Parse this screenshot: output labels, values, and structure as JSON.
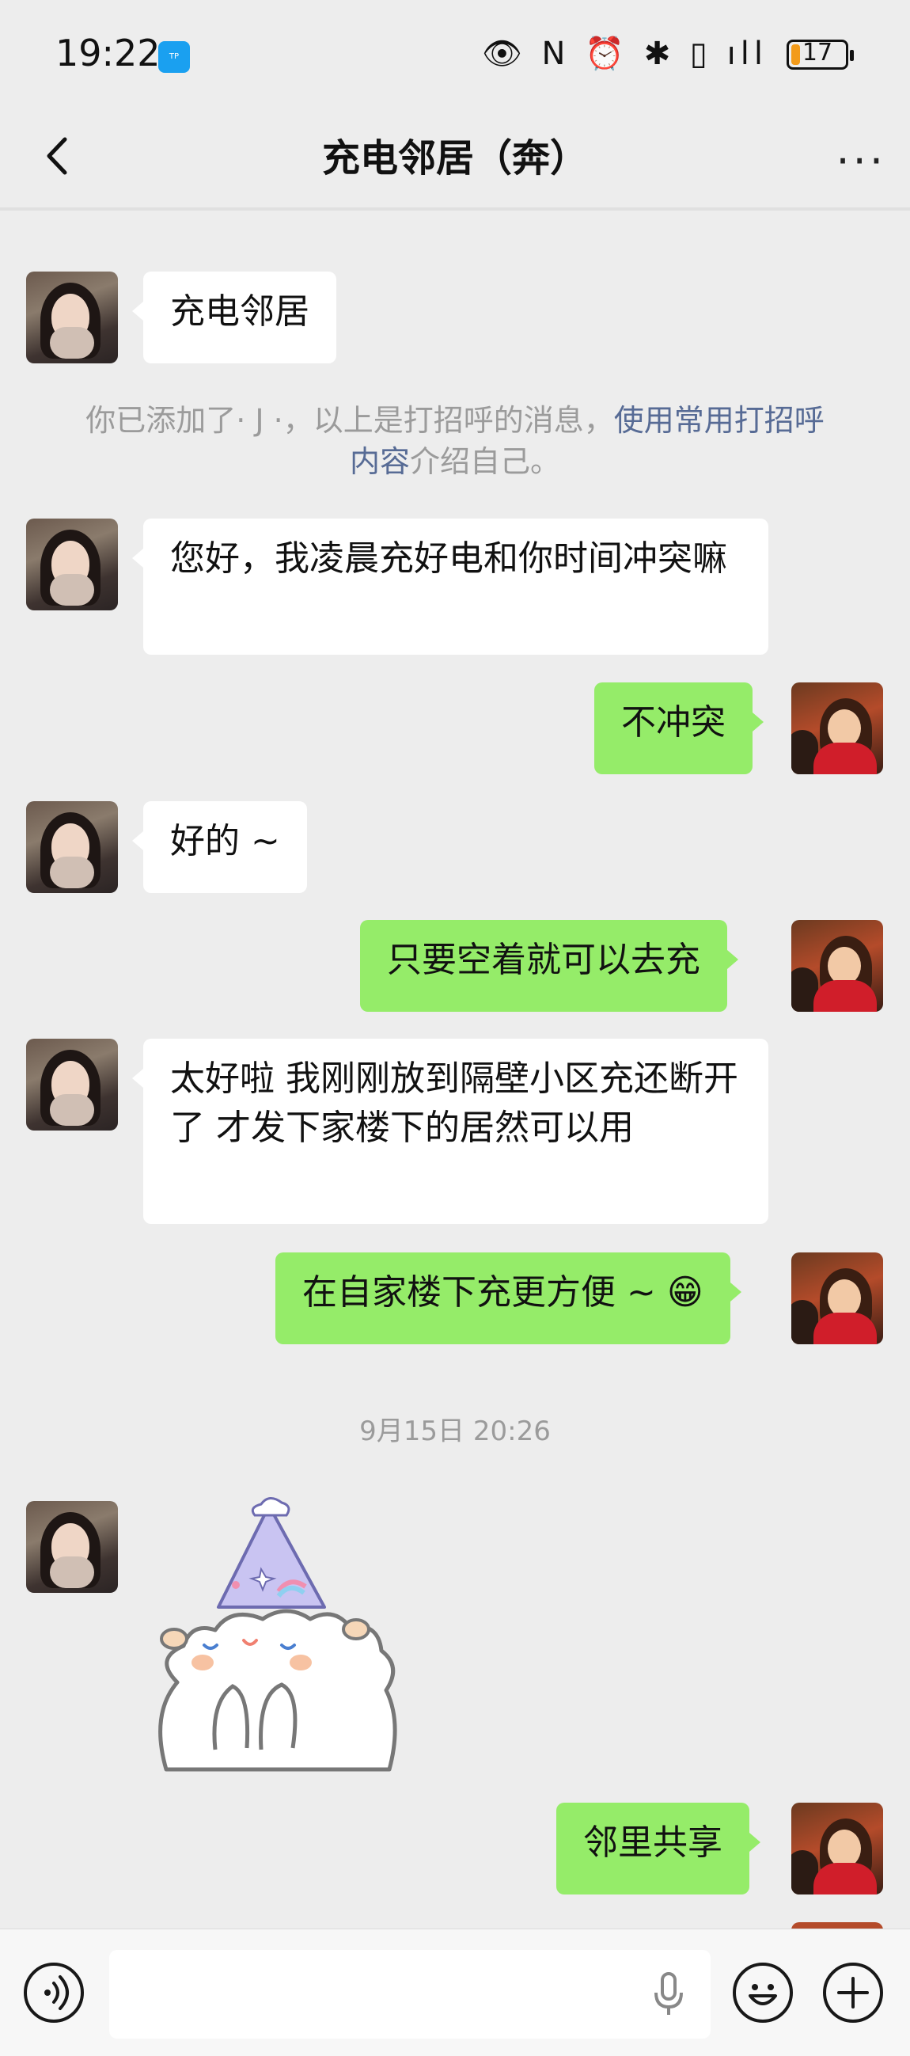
{
  "status_bar": {
    "time": "19:22",
    "app_icon": "tplink-app-icon",
    "system_icons": "👁 N ⏰ ✱ ▯ ıll",
    "battery_level": "17",
    "battery_fraction": 0.17
  },
  "header": {
    "title": "充电邻居（奔）",
    "more_icon": "more-dots-icon",
    "back_icon": "chevron-left-icon"
  },
  "messages": [
    {
      "side": "left",
      "text": "充电邻居"
    },
    {
      "side": "left",
      "text": "您好，我凌晨充好电和你时间冲突嘛"
    },
    {
      "side": "right",
      "text": "不冲突"
    },
    {
      "side": "left",
      "text": "好的 ~"
    },
    {
      "side": "right",
      "text": "只要空着就可以去充"
    },
    {
      "side": "left",
      "text": "太好啦 我刚刚放到隔壁小区充还断开了 才发下家楼下的居然可以用"
    },
    {
      "side": "right",
      "text": "在自家楼下充更方便 ~ 😁"
    },
    {
      "side": "right",
      "text": "邻里共享"
    }
  ],
  "system_message": {
    "prefix": "你已添加了· J ·，以上是打招呼的消息，",
    "link": "使用常用打招呼内容",
    "suffix": "介绍自己。"
  },
  "timestamp": "9月15日 20:26",
  "sticker": {
    "icon": "cute-sheep-party-hat-sticker"
  },
  "input_bar": {
    "voice_icon": "voice-mode-icon",
    "mic_icon": "microphone-icon",
    "emoji_icon": "emoji-face-icon",
    "plus_icon": "plus-icon"
  },
  "colors": {
    "background": "#ededed",
    "bubble_self": "#95ec69",
    "bubble_other": "#ffffff",
    "link": "#576b95"
  }
}
